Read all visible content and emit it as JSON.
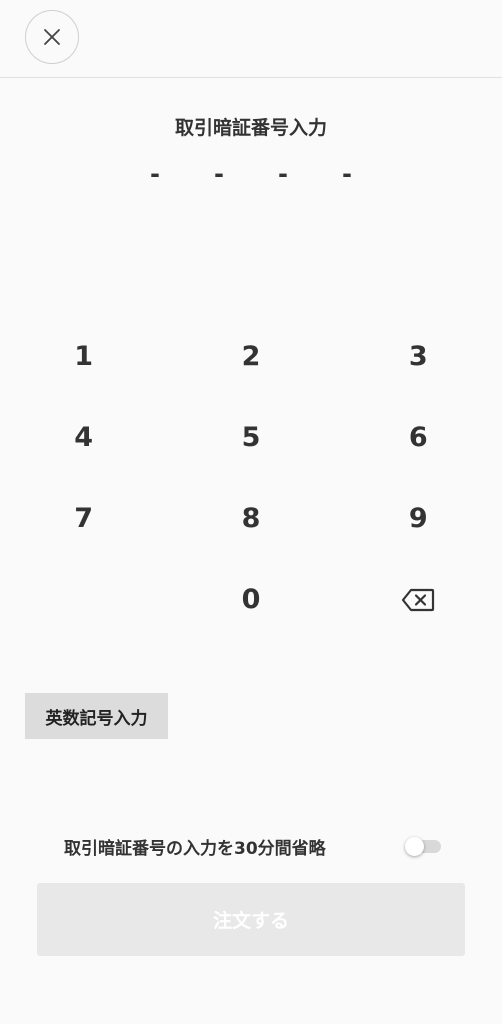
{
  "header": {
    "close_icon": "close-icon"
  },
  "title": "取引暗証番号入力",
  "pin": {
    "slots": [
      "-",
      "-",
      "-",
      "-"
    ]
  },
  "keypad": {
    "rows": [
      [
        "1",
        "2",
        "3"
      ],
      [
        "4",
        "5",
        "6"
      ],
      [
        "7",
        "8",
        "9"
      ],
      [
        "",
        "0",
        "backspace-icon"
      ]
    ]
  },
  "alpha_button": {
    "label": "英数記号入力"
  },
  "skip": {
    "label": "取引暗証番号の入力を30分間省略",
    "enabled": false
  },
  "order_button": {
    "label": "注文する",
    "disabled": true
  },
  "colors": {
    "background": "#fafafa",
    "text": "#333333",
    "alpha_button_bg": "#dcdcdc",
    "order_button_bg": "#e8e8e8",
    "order_button_text": "#ffffff",
    "toggle_track": "#d9d9d9"
  }
}
